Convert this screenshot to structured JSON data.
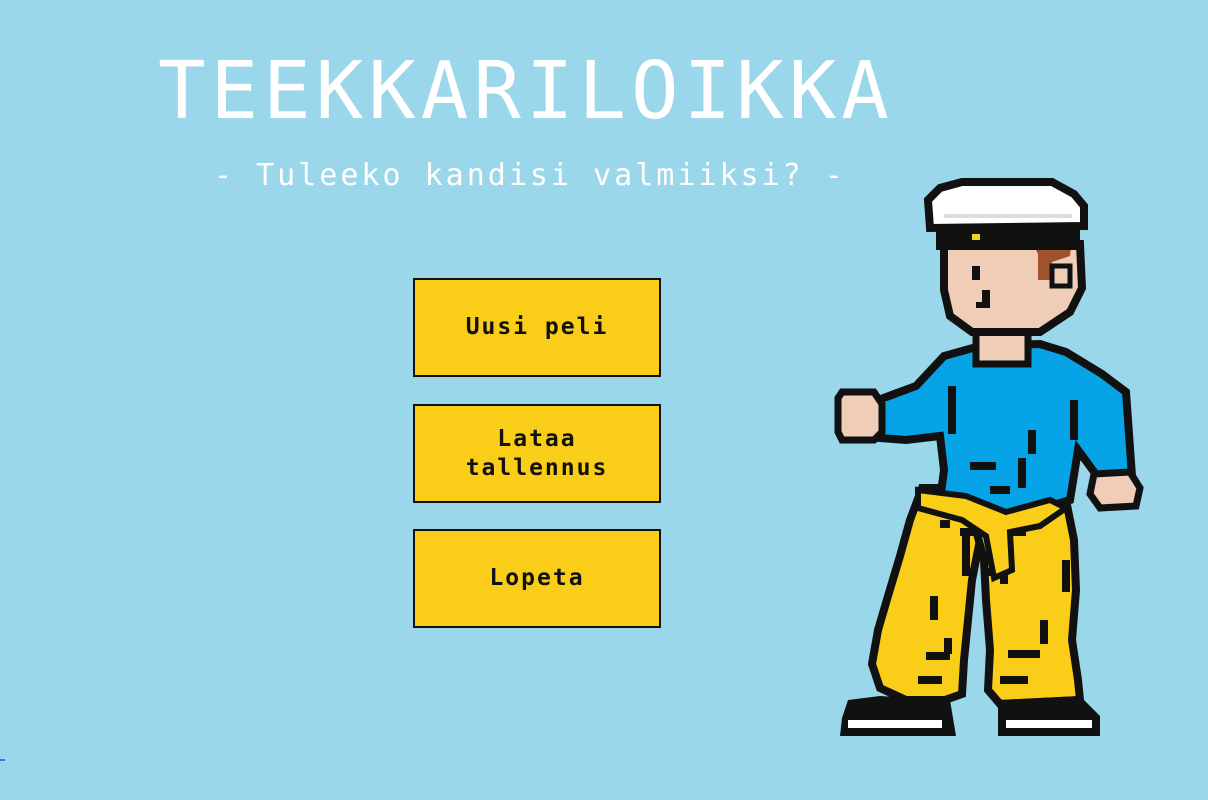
{
  "title": "TEEKKARILOIKKA",
  "subtitle": "- Tuleeko kandisi valmiiksi? -",
  "menu": {
    "new_game": "Uusi peli",
    "load_save": "Lataa\ntallennus",
    "quit": "Lopeta"
  },
  "colors": {
    "background": "#9ad7ea",
    "button": "#facd18",
    "title_text": "#ffffff",
    "shirt": "#06a3e6",
    "pants": "#facd18",
    "skin": "#f0cdb6",
    "hair": "#a0522d",
    "cap": "#ffffff"
  },
  "character": {
    "icon": "teekkari-student-with-cap-icon"
  }
}
